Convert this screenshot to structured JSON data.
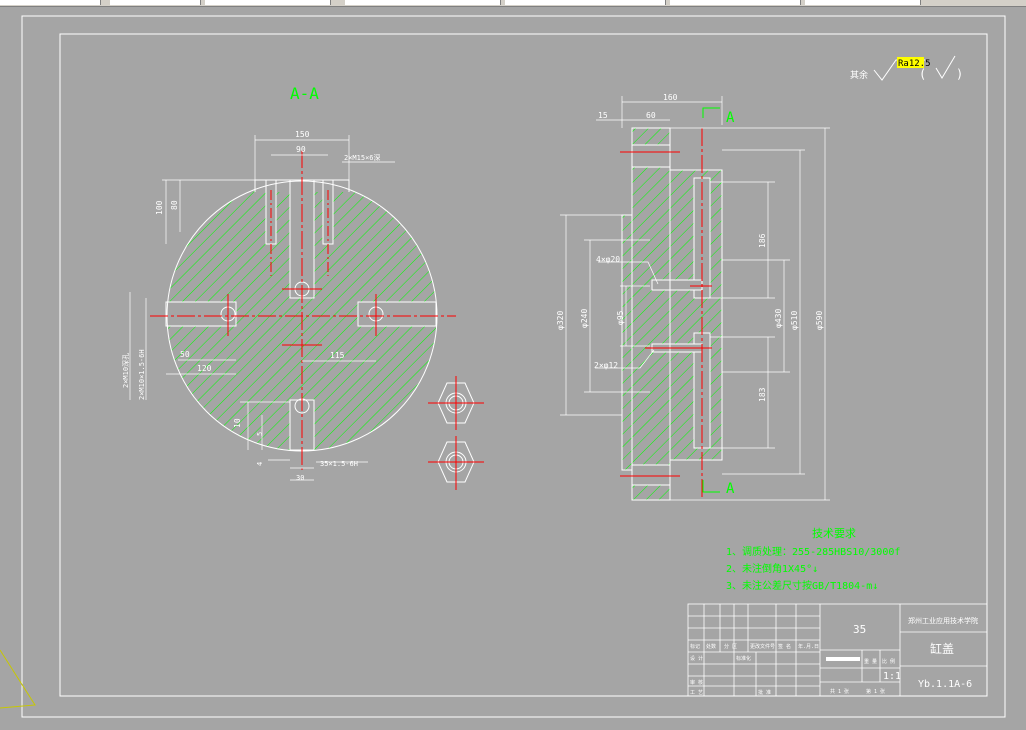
{
  "section_label": "A-A",
  "roughness": {
    "prefix": "其余",
    "value": "Ra12.5",
    "paren_open": "(",
    "paren_close": ")"
  },
  "front_view_dims": {
    "d150": "150",
    "d90": "90",
    "thread_2": "2×M15×6深",
    "d100": "100",
    "d80": "80",
    "d50": "50",
    "d120": "120",
    "d115": "115",
    "left_note_1": "2×M10深孔",
    "left_note_2": "2×M10×1.5-6H",
    "d10": "10",
    "d5": "5",
    "d4": "4",
    "thread_bottom": "35×1.5-6H",
    "d30": "30"
  },
  "side_view_dims": {
    "d160": "160",
    "d15": "15",
    "d60": "60",
    "arrow_top": "A",
    "arrow_bottom": "A",
    "holes_20": "4×φ20",
    "holes_12": "2×φ12",
    "phi320": "φ320",
    "phi240": "φ240",
    "phi95": "φ95",
    "d186": "186",
    "d183": "183",
    "phi430": "φ430",
    "phi510": "φ510",
    "phi590": "φ590"
  },
  "tech_requirements": {
    "title": "技术要求",
    "items": [
      "1、调质处理：255-285HBS10/3000f",
      "2、未注倒角1X45°↓",
      "3、未注公差尺寸按GB/T1804-m↓"
    ]
  },
  "title_block": {
    "material": "35",
    "school": "郑州工业应用技术学院",
    "part_name": "缸盖",
    "scale": "1:1",
    "drawing_no": "Yb.1.1A-6",
    "rev_headers": [
      "标记",
      "处数",
      "分 区",
      "更改文件号",
      "签 名",
      "年.月.日"
    ],
    "design_label": "设 计",
    "std_label": "标准化",
    "review_label": "审 核",
    "process_label": "工 艺",
    "approve_label": "批 准",
    "stage_label": "阶段标记",
    "weight_label": "重 量",
    "scale_label": "比 例",
    "sheets_total": "共 1 张",
    "sheet_no": "第 1 张"
  },
  "colors": {
    "background": "#a5a5a5",
    "lines": "#ffffff",
    "hatch": "#00ff00",
    "center": "#ff0000",
    "annotation": "#00ff00"
  }
}
